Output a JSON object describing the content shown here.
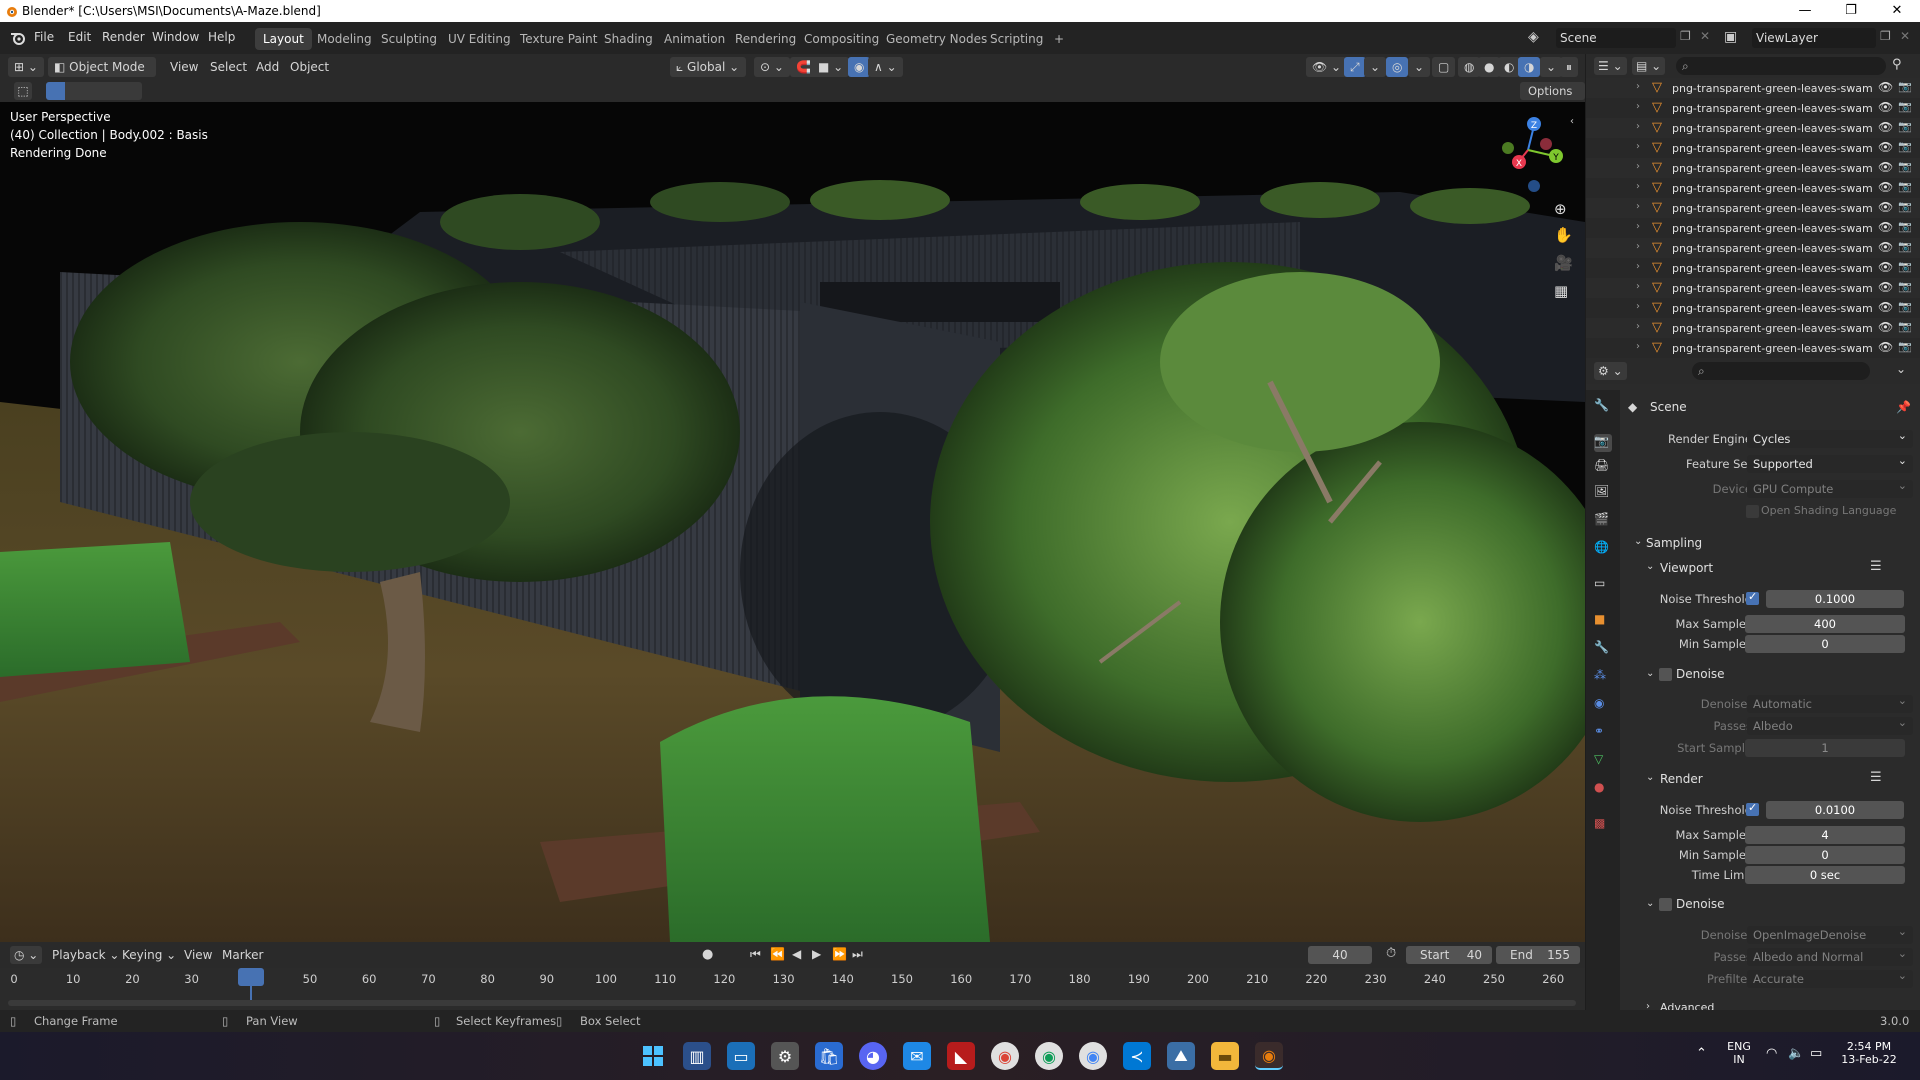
{
  "window": {
    "title": "Blender* [C:\\Users\\MSI\\Documents\\A-Maze.blend]",
    "controls": [
      "—",
      "❐",
      "✕"
    ]
  },
  "menu": {
    "items": [
      "File",
      "Edit",
      "Render",
      "Window",
      "Help"
    ],
    "workspaces": [
      "Layout",
      "Modeling",
      "Sculpting",
      "UV Editing",
      "Texture Paint",
      "Shading",
      "Animation",
      "Rendering",
      "Compositing",
      "Geometry Nodes",
      "Scripting"
    ],
    "active_workspace": "Layout",
    "add_tab": "+",
    "scene": "Scene",
    "view_layer": "ViewLayer"
  },
  "viewport_header": {
    "mode": "Object Mode",
    "menus": [
      "View",
      "Select",
      "Add",
      "Object"
    ],
    "transform": "Global",
    "options": "Options"
  },
  "viewport": {
    "overlay_lines": [
      "User Perspective",
      "(40) Collection | Body.002 : Basis",
      "Rendering Done"
    ],
    "gizmo": {
      "x": "X",
      "y": "Y",
      "z": "Z"
    },
    "colors": {
      "x": "#e8384f",
      "y": "#7ec72e",
      "z": "#3c82e4"
    }
  },
  "outliner": {
    "items": [
      "png-transparent-green-leaves-swamp",
      "png-transparent-green-leaves-swamp",
      "png-transparent-green-leaves-swamp",
      "png-transparent-green-leaves-swamp",
      "png-transparent-green-leaves-swamp",
      "png-transparent-green-leaves-swamp",
      "png-transparent-green-leaves-swamp",
      "png-transparent-green-leaves-swamp",
      "png-transparent-green-leaves-swamp",
      "png-transparent-green-leaves-swamp",
      "png-transparent-green-leaves-swamp",
      "png-transparent-green-leaves-swamp",
      "png-transparent-green-leaves-swamp",
      "png-transparent-green-leaves-swamp"
    ]
  },
  "properties": {
    "context": "Scene",
    "render_engine": {
      "label": "Render Engine",
      "value": "Cycles"
    },
    "feature_set": {
      "label": "Feature Set",
      "value": "Supported"
    },
    "device": {
      "label": "Device",
      "value": "GPU Compute"
    },
    "osl": "Open Shading Language",
    "sampling": "Sampling",
    "viewport": {
      "title": "Viewport",
      "noise_threshold_label": "Noise Threshold",
      "noise_threshold": "0.1000",
      "max_samples_label": "Max Samples",
      "max_samples": "400",
      "min_samples_label": "Min Samples",
      "min_samples": "0",
      "denoise": "Denoise",
      "denoiser_label": "Denoiser",
      "denoiser": "Automatic",
      "passes_label": "Passes",
      "passes": "Albedo",
      "start_sample_label": "Start Sample",
      "start_sample": "1"
    },
    "render": {
      "title": "Render",
      "noise_threshold_label": "Noise Threshold",
      "noise_threshold": "0.0100",
      "max_samples_label": "Max Samples",
      "max_samples": "4",
      "min_samples_label": "Min Samples",
      "min_samples": "0",
      "time_limit_label": "Time Limit",
      "time_limit": "0 sec",
      "denoise": "Denoise",
      "denoiser_label": "Denoiser",
      "denoiser": "OpenImageDenoise",
      "passes_label": "Passes",
      "passes": "Albedo and Normal",
      "prefilter_label": "Prefilter",
      "prefilter": "Accurate"
    },
    "advanced": "Advanced"
  },
  "timeline": {
    "menus": [
      "Playback",
      "Keying",
      "View",
      "Marker"
    ],
    "current_frame": "40",
    "start_label": "Start",
    "start": "40",
    "end_label": "End",
    "end": "155",
    "ticks": [
      "0",
      "10",
      "20",
      "30",
      "40",
      "50",
      "60",
      "70",
      "80",
      "90",
      "100",
      "110",
      "120",
      "130",
      "140",
      "150",
      "160",
      "170",
      "180",
      "190",
      "200",
      "210",
      "220",
      "230",
      "240",
      "250",
      "260"
    ]
  },
  "statusbar": {
    "change_frame": "Change Frame",
    "pan_view": "Pan View",
    "select_keyframes": "Select Keyframes",
    "box_select": "Box Select",
    "version": "3.0.0"
  },
  "taskbar": {
    "lang": "ENG",
    "region": "IN",
    "time": "2:54 PM",
    "date": "13-Feb-22"
  }
}
